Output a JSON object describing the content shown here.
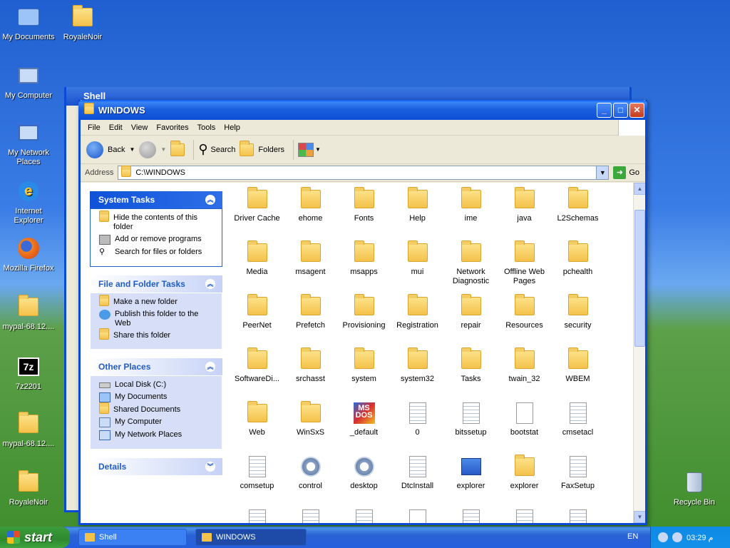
{
  "desktop": {
    "icons": [
      {
        "label": "My Documents"
      },
      {
        "label": "RoyaleNoir"
      },
      {
        "label": "My Computer"
      },
      {
        "label": "My Network Places"
      },
      {
        "label": "Internet Explorer"
      },
      {
        "label": "Mozilla Firefox"
      },
      {
        "label": "mypal-68.12...."
      },
      {
        "label": "7z2201"
      },
      {
        "label": "mypal-68.12...."
      },
      {
        "label": "RoyaleNoir"
      },
      {
        "label": "Recycle Bin"
      }
    ],
    "seven_zip_text": "7z"
  },
  "background_window": {
    "title": "Shell"
  },
  "window": {
    "title": "WINDOWS",
    "menu": [
      "File",
      "Edit",
      "View",
      "Favorites",
      "Tools",
      "Help"
    ],
    "toolbar": {
      "back": "Back",
      "search": "Search",
      "folders": "Folders"
    },
    "address": {
      "label": "Address",
      "value": "C:\\WINDOWS",
      "go": "Go"
    },
    "panels": {
      "system_tasks": {
        "title": "System Tasks",
        "items": [
          "Hide the contents of this folder",
          "Add or remove programs",
          "Search for files or folders"
        ]
      },
      "file_folder_tasks": {
        "title": "File and Folder Tasks",
        "items": [
          "Make a new folder",
          "Publish this folder to the Web",
          "Share this folder"
        ]
      },
      "other_places": {
        "title": "Other Places",
        "items": [
          "Local Disk (C:)",
          "My Documents",
          "Shared Documents",
          "My Computer",
          "My Network Places"
        ]
      },
      "details": {
        "title": "Details"
      }
    },
    "items": [
      {
        "name": "Driver Cache",
        "icon": "folder-icon"
      },
      {
        "name": "ehome",
        "icon": "folder-icon"
      },
      {
        "name": "Fonts",
        "icon": "folder-icon"
      },
      {
        "name": "Help",
        "icon": "folder-icon"
      },
      {
        "name": "ime",
        "icon": "folder-icon"
      },
      {
        "name": "java",
        "icon": "folder-icon"
      },
      {
        "name": "L2Schemas",
        "icon": "folder-icon"
      },
      {
        "name": "Media",
        "icon": "folder-icon"
      },
      {
        "name": "msagent",
        "icon": "folder-icon"
      },
      {
        "name": "msapps",
        "icon": "folder-icon"
      },
      {
        "name": "mui",
        "icon": "folder-icon"
      },
      {
        "name": "Network Diagnostic",
        "icon": "folder-icon"
      },
      {
        "name": "Offline Web Pages",
        "icon": "offline-folder-icon"
      },
      {
        "name": "pchealth",
        "icon": "folder-icon"
      },
      {
        "name": "PeerNet",
        "icon": "folder-icon"
      },
      {
        "name": "Prefetch",
        "icon": "folder-icon"
      },
      {
        "name": "Provisioning",
        "icon": "folder-icon"
      },
      {
        "name": "Registration",
        "icon": "folder-icon"
      },
      {
        "name": "repair",
        "icon": "folder-icon"
      },
      {
        "name": "Resources",
        "icon": "folder-icon"
      },
      {
        "name": "security",
        "icon": "folder-icon"
      },
      {
        "name": "SoftwareDi...",
        "icon": "folder-icon"
      },
      {
        "name": "srchasst",
        "icon": "folder-icon"
      },
      {
        "name": "system",
        "icon": "folder-icon"
      },
      {
        "name": "system32",
        "icon": "folder-icon"
      },
      {
        "name": "Tasks",
        "icon": "tasks-folder-icon"
      },
      {
        "name": "twain_32",
        "icon": "folder-icon"
      },
      {
        "name": "WBEM",
        "icon": "folder-icon"
      },
      {
        "name": "Web",
        "icon": "folder-icon"
      },
      {
        "name": "WinSxS",
        "icon": "folder-icon"
      },
      {
        "name": "_default",
        "icon": "msdos-icon"
      },
      {
        "name": "0",
        "icon": "file-icon"
      },
      {
        "name": "bitssetup",
        "icon": "file-icon"
      },
      {
        "name": "bootstat",
        "icon": "blank-file-icon"
      },
      {
        "name": "cmsetacl",
        "icon": "file-icon"
      },
      {
        "name": "comsetup",
        "icon": "file-icon"
      },
      {
        "name": "control",
        "icon": "gear-icon"
      },
      {
        "name": "desktop",
        "icon": "gear-icon"
      },
      {
        "name": "DtcInstall",
        "icon": "file-icon"
      },
      {
        "name": "explorer",
        "icon": "explorer-app-icon"
      },
      {
        "name": "explorer",
        "icon": "explorer-folder-icon"
      },
      {
        "name": "FaxSetup",
        "icon": "file-icon"
      }
    ],
    "partial_row": [
      "help-file-icon",
      "file-icon",
      "file-icon",
      "blank-file-icon",
      "file-icon",
      "file-icon",
      "file-icon"
    ]
  },
  "taskbar": {
    "start": "start",
    "tasks": [
      "Shell",
      "WINDOWS"
    ],
    "language": "EN",
    "clock": "03:29 م"
  },
  "colors": {
    "xp_blue": "#0a4ad6",
    "start_green": "#3c9c3c",
    "folder_yellow": "#f4c24a"
  }
}
